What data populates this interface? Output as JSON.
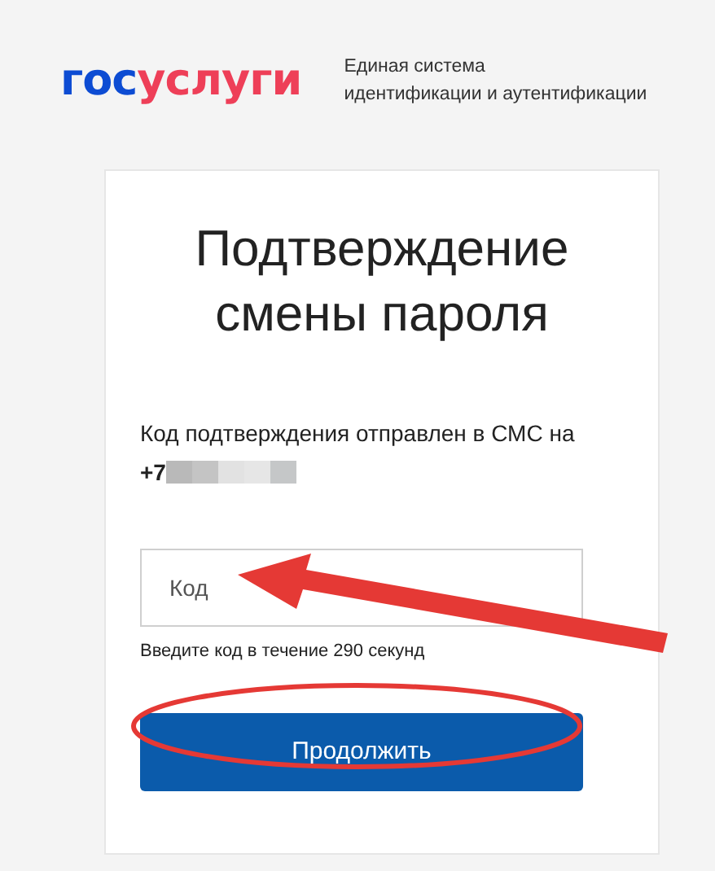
{
  "logo": [
    {
      "text": "гос",
      "color": "#0d4cd3"
    },
    {
      "text": "услуги",
      "color": "#ee3f58"
    }
  ],
  "tagline": "Единая система\nидентификации и аутентификации",
  "card": {
    "title": "Подтверждение смены пароля",
    "message": "Код подтверждения отправлен в СМС на",
    "phone": "+7",
    "code_field": {
      "placeholder": "Код"
    },
    "hint": "Введите код в течение 290 секунд",
    "button": "Продолжить"
  },
  "annotations": [
    {
      "kind": "arrow"
    },
    {
      "kind": "ellipse"
    }
  ]
}
